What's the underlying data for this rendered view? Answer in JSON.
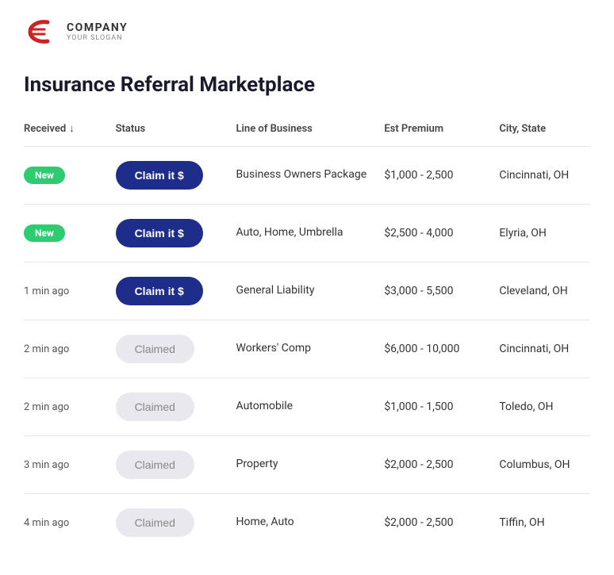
{
  "header": {
    "company": "COMPANY",
    "slogan": "YOUR SLOGAN"
  },
  "page": {
    "title": "Insurance Referral Marketplace"
  },
  "table": {
    "columns": [
      "Received",
      "Status",
      "Line of Business",
      "Est Premium",
      "City, State"
    ],
    "rows": [
      {
        "received": "New",
        "received_type": "badge",
        "status": "Claim it $",
        "status_type": "claim",
        "lob": "Business Owners Package",
        "premium": "$1,000 - 2,500",
        "city": "Cincinnati, OH"
      },
      {
        "received": "New",
        "received_type": "badge",
        "status": "Claim it $",
        "status_type": "claim",
        "lob": "Auto, Home, Umbrella",
        "premium": "$2,500 - 4,000",
        "city": "Elyria, OH"
      },
      {
        "received": "1 min ago",
        "received_type": "text",
        "status": "Claim it $",
        "status_type": "claim",
        "lob": "General Liability",
        "premium": "$3,000 - 5,500",
        "city": "Cleveland, OH"
      },
      {
        "received": "2 min ago",
        "received_type": "text",
        "status": "Claimed",
        "status_type": "claimed",
        "lob": "Workers' Comp",
        "premium": "$6,000 - 10,000",
        "city": "Cincinnati, OH"
      },
      {
        "received": "2 min ago",
        "received_type": "text",
        "status": "Claimed",
        "status_type": "claimed",
        "lob": "Automobile",
        "premium": "$1,000 - 1,500",
        "city": "Toledo, OH"
      },
      {
        "received": "3 min ago",
        "received_type": "text",
        "status": "Claimed",
        "status_type": "claimed",
        "lob": "Property",
        "premium": "$2,000 - 2,500",
        "city": "Columbus, OH"
      },
      {
        "received": "4 min ago",
        "received_type": "text",
        "status": "Claimed",
        "status_type": "claimed",
        "lob": "Home, Auto",
        "premium": "$2,000 - 2,500",
        "city": "Tiffin, OH"
      }
    ]
  }
}
